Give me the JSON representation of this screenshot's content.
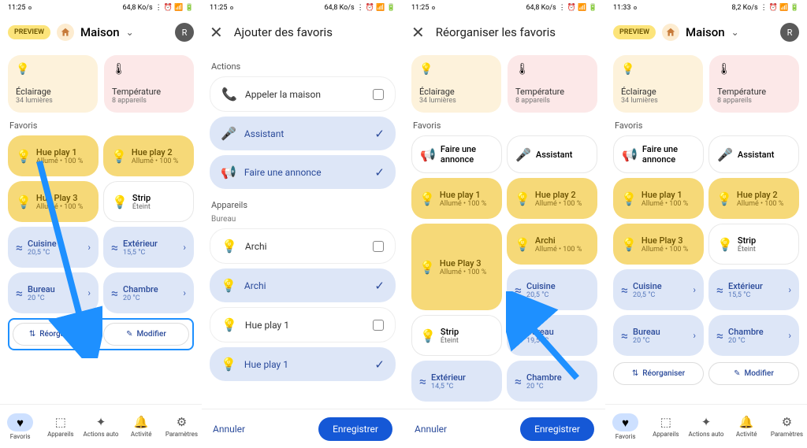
{
  "statusbar": {
    "time1": "11:25",
    "time2": "11:33",
    "net1": "64,8 Ko/s",
    "net2": "8,2 Ko/s"
  },
  "header": {
    "preview": "PREVIEW",
    "home": "Maison",
    "avatar": "R"
  },
  "modal": {
    "addFav": "Ajouter des favoris",
    "reorg": "Réorganiser les favoris"
  },
  "top": {
    "light": {
      "title": "Éclairage",
      "sub": "34 lumières"
    },
    "temp": {
      "title": "Température",
      "sub": "8 appareils"
    }
  },
  "labels": {
    "favoris": "Favoris",
    "actions": "Actions",
    "appareils": "Appareils",
    "bureau": "Bureau"
  },
  "devices": {
    "hue1": {
      "title": "Hue play 1",
      "sub": "Allumé • 100 %"
    },
    "hue2": {
      "title": "Hue play 2",
      "sub": "Allumé • 100 %"
    },
    "hue3": {
      "title": "Hue Play 3",
      "sub": "Allumé • 100 %"
    },
    "strip": {
      "title": "Strip",
      "sub": "Éteint"
    },
    "archi": {
      "title": "Archi",
      "sub": "Allumé • 100 %"
    },
    "cuisine": {
      "title": "Cuisine",
      "sub": "20,5 °C"
    },
    "ext": {
      "title": "Extérieur",
      "sub": "15,5 °C"
    },
    "ext14": {
      "title": "Extérieur",
      "sub": "14,5 °C"
    },
    "bureau": {
      "title": "Bureau",
      "sub": "20 °C"
    },
    "bureau19": {
      "title": "Bureau",
      "sub": "19,5 °C"
    },
    "chambre": {
      "title": "Chambre",
      "sub": "20 °C"
    }
  },
  "actions": {
    "reorg": "Réorganiser",
    "mod": "Modifier",
    "callHome": "Appeler la maison",
    "assistant": "Assistant",
    "announce": "Faire une annonce",
    "archi": "Archi",
    "huep1": "Hue play 1"
  },
  "nav": {
    "fav": "Favoris",
    "dev": "Appareils",
    "auto": "Actions auto",
    "act": "Activité",
    "set": "Paramètres"
  },
  "btn": {
    "cancel": "Annuler",
    "save": "Enregistrer"
  }
}
